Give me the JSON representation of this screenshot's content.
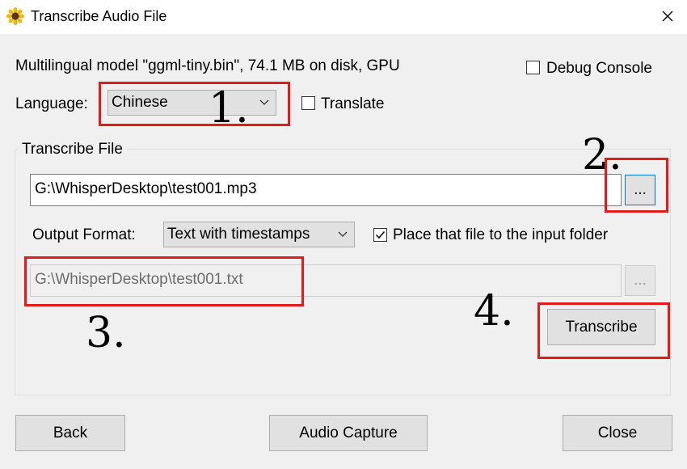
{
  "window": {
    "title": "Transcribe Audio File"
  },
  "model_info": "Multilingual model \"ggml-tiny.bin\", 74.1 MB on disk, GPU",
  "debug_console": {
    "label": "Debug Console",
    "checked": false
  },
  "language": {
    "label": "Language:",
    "selected": "Chinese"
  },
  "translate": {
    "label": "Translate",
    "checked": false
  },
  "transcribe_group": {
    "title": "Transcribe File",
    "input_path": "G:\\WhisperDesktop\\test001.mp3",
    "browse_input_label": "...",
    "output_format_label": "Output Format:",
    "output_format_selected": "Text with timestamps",
    "place_in_input_folder": {
      "label": "Place that file to the input folder",
      "checked": true
    },
    "output_path": "G:\\WhisperDesktop\\test001.txt",
    "browse_output_label": "...",
    "transcribe_label": "Transcribe"
  },
  "footer": {
    "back_label": "Back",
    "audio_capture_label": "Audio Capture",
    "close_label": "Close"
  },
  "annotations": {
    "step1": "1.",
    "step2": "2.",
    "step3": "3.",
    "step4": "4."
  },
  "colors": {
    "highlight_box": "#e41b1b",
    "focus_border": "#0078d7"
  }
}
